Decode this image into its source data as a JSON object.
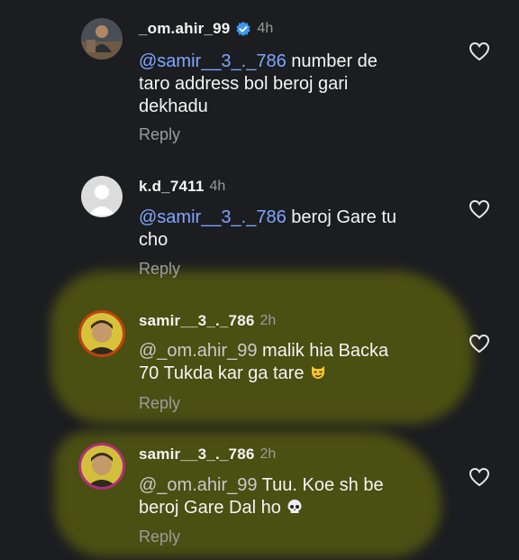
{
  "comments": [
    {
      "username": "_om.ahir_99",
      "verified": true,
      "time": "4h",
      "mention": "@samir__3_._786",
      "text_line1": " number de",
      "text_line2": "taro address bol beroj gari",
      "text_line3": "dekhadu",
      "reply": "Reply"
    },
    {
      "username": "k.d_7411",
      "time": "4h",
      "mention": "@samir__3_._786",
      "text_line1": " beroj Gare tu",
      "text_line2": "cho",
      "reply": "Reply"
    },
    {
      "username": "samir__3_._786",
      "time": "2h",
      "mention": "@_om.ahir_99",
      "text_line1": "  malik  hia Backa",
      "text_line2": "70 Tukda kar ga tare ",
      "emoji": "smirking-cat-face",
      "reply": "Reply"
    },
    {
      "username": "samir__3_._786",
      "time": "2h",
      "mention": "@_om.ahir_99",
      "text_line1": "  Tuu. Koe sh be",
      "text_line2": "beroj Gare Dal ho ",
      "emoji": "skull",
      "reply": "Reply"
    }
  ],
  "colors": {
    "background": "#1c1d20",
    "mention": "#7fa6ff",
    "highlight": "#686e0a",
    "verified": "#3897f0"
  }
}
